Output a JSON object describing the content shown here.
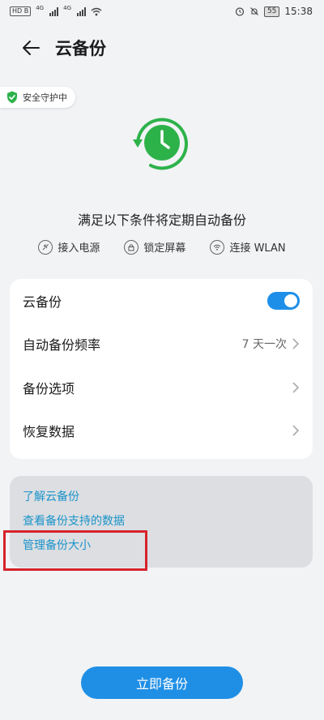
{
  "status_bar": {
    "hd_label": "HD B",
    "signal_tag_1": "4G",
    "signal_tag_2": "4G",
    "battery": "55",
    "time": "15:38"
  },
  "header": {
    "title": "云备份",
    "back_icon": "arrow-left-icon"
  },
  "security_badge": {
    "label": "安全守护中",
    "icon": "shield-check-icon",
    "color": "#2db24a"
  },
  "hero": {
    "icon": "clock-backup-icon",
    "icon_color": "#2db24a",
    "condition_title": "满足以下条件将定期自动备份",
    "conditions": [
      {
        "label": "接入电源",
        "icon": "plug-icon"
      },
      {
        "label": "锁定屏幕",
        "icon": "lock-icon"
      },
      {
        "label": "连接 WLAN",
        "icon": "wifi-icon"
      }
    ]
  },
  "settings": {
    "cloud_backup_label": "云备份",
    "cloud_backup_enabled": true,
    "frequency_label": "自动备份频率",
    "frequency_value": "7 天一次",
    "options_label": "备份选项",
    "restore_label": "恢复数据"
  },
  "links": {
    "learn": "了解云备份",
    "supported_data": "查看备份支持的数据",
    "manage_size": "管理备份大小",
    "color": "#1b93c9"
  },
  "primary_button": {
    "label": "立即备份",
    "color": "#1f8fe6"
  }
}
